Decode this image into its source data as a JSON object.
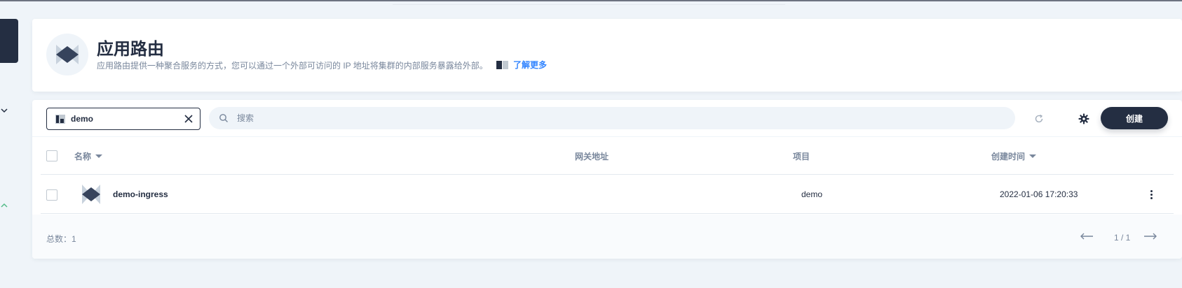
{
  "header": {
    "title": "应用路由",
    "description": "应用路由提供一种聚合服务的方式，您可以通过一个外部可访问的 IP 地址将集群的内部服务暴露给外部。",
    "learn_more": "了解更多"
  },
  "toolbar": {
    "namespace_value": "demo",
    "search_placeholder": "搜索",
    "create_label": "创建"
  },
  "table": {
    "columns": [
      "名称",
      "网关地址",
      "项目",
      "创建时间"
    ],
    "rows": [
      {
        "name": "demo-ingress",
        "gateway": "",
        "project": "demo",
        "created": "2022-01-06 17:20:33"
      }
    ]
  },
  "footer": {
    "total_label": "总数：1",
    "page": "1 / 1"
  },
  "colors": {
    "primary_dark": "#242e42",
    "muted_text": "#79879c",
    "link_blue": "#3385ff",
    "background": "#eff4f9"
  },
  "icons": [
    "ingress-logo-icon",
    "book-icon",
    "project-icon",
    "close-icon",
    "search-icon",
    "refresh-icon",
    "gear-icon",
    "more-icon",
    "arrow-left-icon",
    "arrow-right-icon",
    "chevron-down-icon",
    "chevron-up-icon"
  ]
}
